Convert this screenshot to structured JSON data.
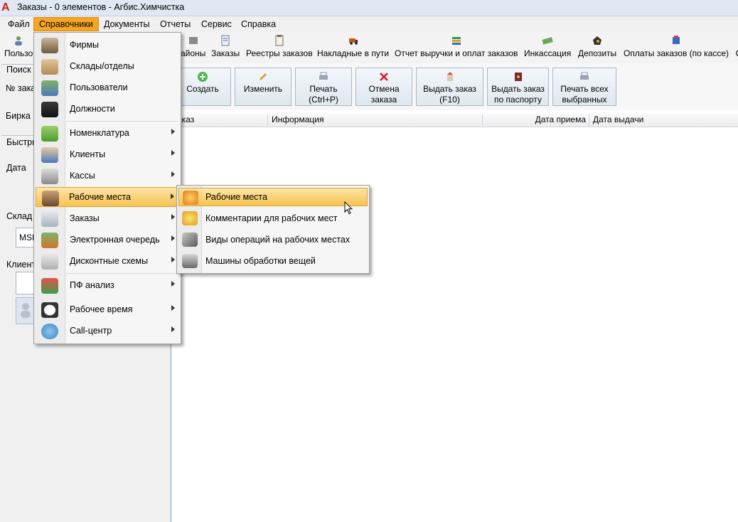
{
  "window": {
    "title": "Заказы - 0 элементов - Агбис.Химчистка",
    "logo_letter": "A"
  },
  "menubar": {
    "items": [
      "Файл",
      "Справочники",
      "Документы",
      "Отчеты",
      "Сервис",
      "Справка"
    ],
    "active": "Справочники"
  },
  "toolbar": {
    "items": [
      {
        "label": "Пользо",
        "icon": "users-icon"
      },
      {
        "label": "айоны",
        "icon": "districts-icon"
      },
      {
        "label": "Заказы",
        "icon": "orders-icon"
      },
      {
        "label": "Реестры заказов",
        "icon": "registers-icon"
      },
      {
        "label": "Накладные в пути",
        "icon": "truck-icon"
      },
      {
        "label": "Отчет выручки и оплат заказов",
        "icon": "books-icon"
      },
      {
        "label": "Инкассация",
        "icon": "money-icon"
      },
      {
        "label": "Депозиты",
        "icon": "deposit-icon"
      },
      {
        "label": "Оплаты заказов (по кассе)",
        "icon": "payment-icon"
      },
      {
        "label": "С",
        "icon": ""
      }
    ]
  },
  "left_panel": {
    "search_label": "Поиск з",
    "order_no_label": "№ заказ",
    "tag_label": "Бирка",
    "quick_label": "Быстры",
    "date_label": "Дата",
    "warehouse_label": "Склад п",
    "warehouse_value": "MSP",
    "client_label": "Клиент"
  },
  "actions": {
    "create": "Создать",
    "edit": "Изменить",
    "print": "Печать (Ctrl+P)",
    "cancel_order": "Отмена заказа",
    "issue_order": "Выдать заказ (F10)",
    "issue_passport": "Выдать заказ по паспорту",
    "print_selected": "Печать всех выбранных"
  },
  "grid": {
    "columns": [
      "аказ",
      "Информация",
      "Дата приема",
      "Дата выдачи"
    ]
  },
  "dropdown": {
    "items": [
      {
        "label": "Фирмы",
        "icon": "stamp-icon",
        "submenu": false
      },
      {
        "label": "Склады/отделы",
        "icon": "boxes-icon",
        "submenu": false
      },
      {
        "label": "Пользователи",
        "icon": "users-icon",
        "submenu": false
      },
      {
        "label": "Должности",
        "icon": "briefcase-icon",
        "submenu": false
      },
      {
        "label": "Номенклатура",
        "icon": "basket-icon",
        "submenu": true
      },
      {
        "label": "Клиенты",
        "icon": "client-icon",
        "submenu": true
      },
      {
        "label": "Кассы",
        "icon": "cash-register-icon",
        "submenu": true
      },
      {
        "label": "Рабочие места",
        "icon": "workplace-icon",
        "submenu": true
      },
      {
        "label": "Заказы",
        "icon": "orders-icon",
        "submenu": true
      },
      {
        "label": "Электронная очередь",
        "icon": "queue-icon",
        "submenu": true
      },
      {
        "label": "Дисконтные схемы",
        "icon": "percent-icon",
        "submenu": true
      },
      {
        "label": "ПФ анализ",
        "icon": "analysis-icon",
        "submenu": true
      },
      {
        "label": "Рабочее время",
        "icon": "clock-icon",
        "submenu": true
      },
      {
        "label": "Call-центр",
        "icon": "phone-icon",
        "submenu": true
      }
    ],
    "highlighted": "Рабочие места"
  },
  "submenu": {
    "items": [
      {
        "label": "Рабочие места",
        "icon": "hardhat-icon"
      },
      {
        "label": "Комментарии для рабочих мест",
        "icon": "hardhat-comment-icon"
      },
      {
        "label": "Виды операций на рабочих местах",
        "icon": "tools-icon"
      },
      {
        "label": "Машины обработки вещей",
        "icon": "machine-icon"
      }
    ],
    "highlighted": "Рабочие места"
  },
  "colors": {
    "highlight": "#f6c350",
    "accent": "#f5a623",
    "titlebar": "#dfe8f3"
  }
}
